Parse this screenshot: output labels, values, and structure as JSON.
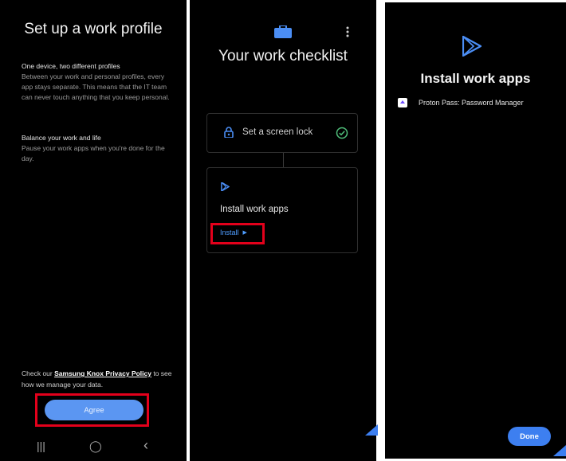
{
  "panel1": {
    "title": "Set up a work profile",
    "section1_heading": "One device, two different profiles",
    "section1_body": "Between your work and personal profiles, every app stays separate. This means that the IT team can never touch anything that you keep personal.",
    "section2_heading": "Balance your work and life",
    "section2_body": "Pause your work apps when you're done for the day.",
    "policy_prefix": "Check our ",
    "policy_link": "Samsung Knox Privacy Policy",
    "policy_suffix": " to see how we manage your data.",
    "agree_label": "Agree",
    "nav": {
      "recents": "|||",
      "home": "◯",
      "back": "‹"
    }
  },
  "panel2": {
    "title": "Your work checklist",
    "step1_label": "Set a screen lock",
    "step2_label": "Install work apps",
    "install_label": "Install",
    "install_arrow": "▶"
  },
  "panel3": {
    "title": "Install work apps",
    "app_name": "Proton Pass: Password Manager",
    "done_label": "Done"
  },
  "colors": {
    "accent_blue": "#5b96f2",
    "link_blue": "#4f9dff",
    "highlight_red": "#e3001b",
    "check_green": "#4fbf7a"
  },
  "icons": [
    "briefcase-icon",
    "kebab-menu-icon",
    "lock-icon",
    "check-circle-icon",
    "play-store-icon",
    "proton-pass-icon"
  ]
}
